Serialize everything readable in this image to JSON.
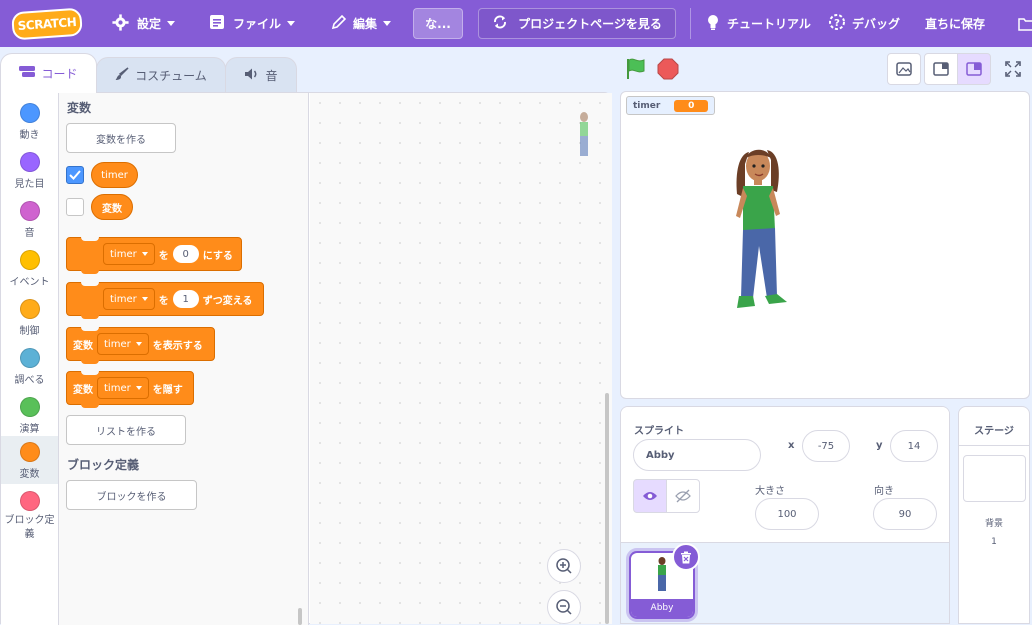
{
  "menubar": {
    "logo": "SCRATCH",
    "settings": "設定",
    "file": "ファイル",
    "edit": "編集",
    "title_box": "な...",
    "project_page": "プロジェクトページを見る",
    "tutorials": "チュートリアル",
    "debug": "デバッグ",
    "save_now": "直ちに保存"
  },
  "tabs": [
    {
      "label": "コード",
      "icon": "code-icon"
    },
    {
      "label": "コスチューム",
      "icon": "brush-icon"
    },
    {
      "label": "音",
      "icon": "speaker-icon"
    }
  ],
  "categories": [
    {
      "label": "動き",
      "color": "#4c97ff"
    },
    {
      "label": "見た目",
      "color": "#9966ff"
    },
    {
      "label": "音",
      "color": "#cf63cf"
    },
    {
      "label": "イベント",
      "color": "#ffbf00"
    },
    {
      "label": "制御",
      "color": "#ffab19"
    },
    {
      "label": "調べる",
      "color": "#5cb1d6"
    },
    {
      "label": "演算",
      "color": "#59c059"
    },
    {
      "label": "変数",
      "color": "#ff8c1a"
    },
    {
      "label": "ブロック定義",
      "color": "#ff6680"
    }
  ],
  "flyout": {
    "variables_heading": "変数",
    "make_variable": "変数を作る",
    "var_timer": "timer",
    "var_hensu": "変数",
    "block1": {
      "dropdown": "timer",
      "text1": "を",
      "value": "0",
      "text2": "にする"
    },
    "block2": {
      "dropdown": "timer",
      "text1": "を",
      "value": "1",
      "text2": "ずつ変える"
    },
    "block3": {
      "prefix": "変数",
      "dropdown": "timer",
      "text1": "を表示する"
    },
    "block4": {
      "prefix": "変数",
      "dropdown": "timer",
      "text1": "を隠す"
    },
    "make_list": "リストを作る",
    "my_blocks_heading": "ブロック定義",
    "make_block": "ブロックを作る"
  },
  "stage": {
    "monitor_label": "timer",
    "monitor_value": "0"
  },
  "sprite_info": {
    "sprite_label": "スプライト",
    "sprite_name": "Abby",
    "x_label": "x",
    "x_value": "-75",
    "y_label": "y",
    "y_value": "14",
    "size_label": "大きさ",
    "size_value": "100",
    "direction_label": "向き",
    "direction_value": "90"
  },
  "sprite_list": [
    {
      "name": "Abby"
    }
  ],
  "stage_panel": {
    "label": "ステージ",
    "backdrops_label": "背景",
    "backdrops_count": "1"
  },
  "colors": {
    "accent": "#855cd6",
    "variables": "#ff8c1a",
    "green_flag": "#4cbf56",
    "stop": "#ec5959"
  }
}
